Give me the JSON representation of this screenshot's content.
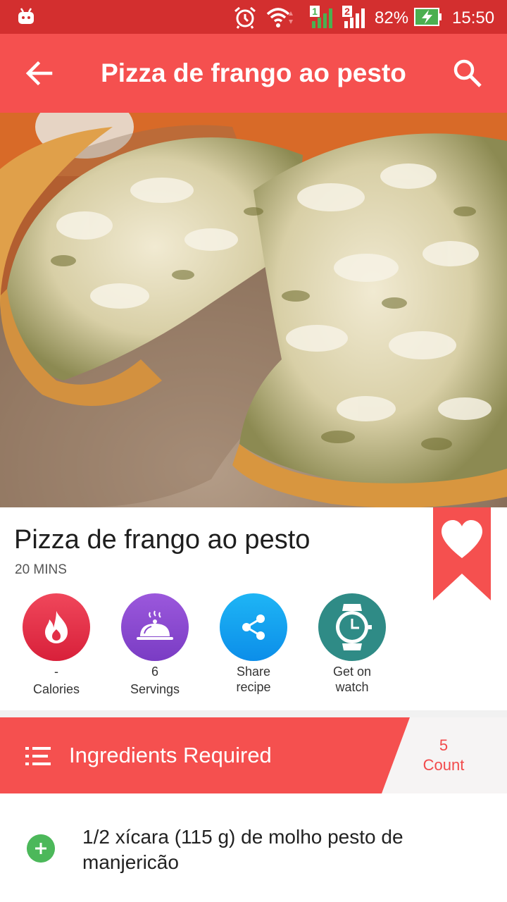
{
  "status_bar": {
    "battery_percent": "82%",
    "time": "15:50",
    "sim1_label": "1",
    "sim2_label": "2"
  },
  "toolbar": {
    "title": "Pizza de frango ao pesto"
  },
  "recipe": {
    "title": "Pizza de frango ao pesto",
    "time": "20 MINS"
  },
  "stats": {
    "calories": {
      "value": "-",
      "label": "Calories"
    },
    "servings": {
      "value": "6",
      "label": "Servings"
    },
    "share": {
      "line1": "Share",
      "line2": "recipe"
    },
    "watch": {
      "line1": "Get on",
      "line2": "watch"
    }
  },
  "ingredients": {
    "header_label": "Ingredients Required",
    "count_value": "5",
    "count_label": "Count",
    "items": [
      {
        "text": "1/2 xícara (115 g) de molho pesto de manjericão"
      }
    ]
  },
  "colors": {
    "status_bar": "#d32f2f",
    "toolbar": "#f5504f",
    "accent_red": "#f24a4b",
    "plus_green": "#4cb85a"
  },
  "icons": {
    "back": "arrow-back-icon",
    "search": "search-icon",
    "favorite": "heart-icon",
    "calories": "flame-icon",
    "servings": "cloche-icon",
    "share": "share-icon",
    "watch": "watch-icon",
    "list": "list-icon",
    "add": "plus-icon"
  }
}
